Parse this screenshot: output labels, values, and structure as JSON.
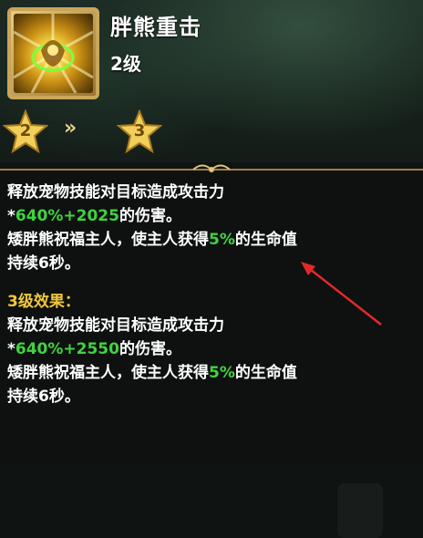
{
  "skill": {
    "name": "胖熊重击",
    "level": "2级"
  },
  "upgrade": {
    "from_level": "2",
    "to_level": "3",
    "arrow_glyph": "»"
  },
  "current_effect": {
    "line1": "释放宠物技能对目标造成攻击力",
    "line2_prefix": "*",
    "line2_value": "640%+2025",
    "line2_suffix": "的伤害。",
    "line3_prefix": "矮胖熊祝福主人，使主人获得",
    "line3_value": "5%",
    "line3_suffix": "的生命值",
    "line4": "持续6秒。"
  },
  "next_effect": {
    "heading": "3级效果：",
    "line1": "释放宠物技能对目标造成攻击力",
    "line2_prefix": "*",
    "line2_value": "640%+2550",
    "line2_suffix": "的伤害。",
    "line3_prefix": "矮胖熊祝福主人，使主人获得",
    "line3_value": "5%",
    "line3_suffix": "的生命值",
    "line4": "持续6秒。"
  },
  "colors": {
    "highlight_green": "#3fd43f",
    "heading_gold": "#f0c83a",
    "frame_gold": "#c9a65a",
    "annotation_red": "#e02a2a"
  },
  "icons": {
    "skill": "bear-slam-skill-icon",
    "star": "star-icon",
    "arrow": "double-chevron-right-icon",
    "annotation": "red-arrow-annotation"
  }
}
